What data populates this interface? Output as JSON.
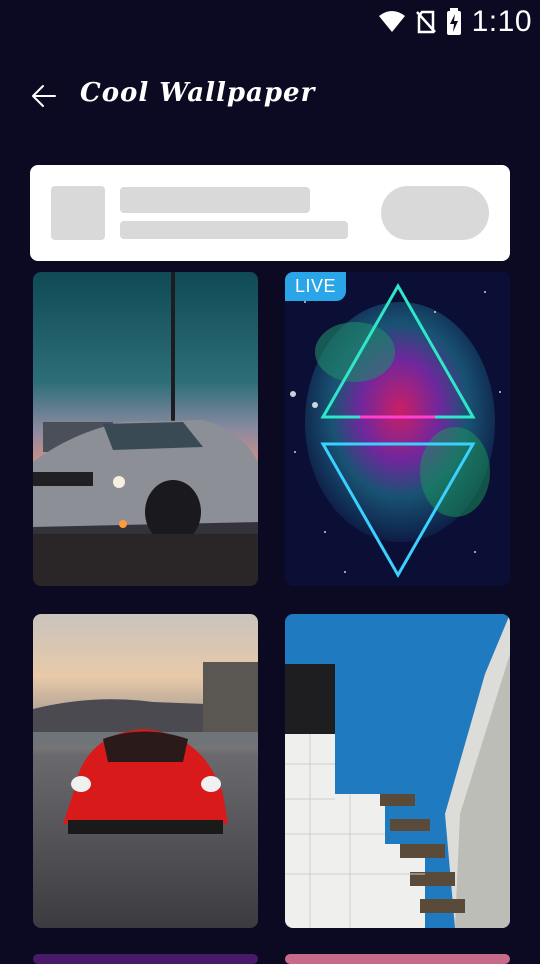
{
  "status_bar": {
    "time": "1:10",
    "icons": [
      "wifi-icon",
      "no-sim-icon",
      "battery-charging-icon"
    ]
  },
  "header": {
    "back_icon": "arrow-left-icon",
    "title": "Cool Wallpaper"
  },
  "wallpapers": [
    {
      "name": "wallpaper-muscle-car-dusk",
      "live": false
    },
    {
      "name": "wallpaper-neon-triangles-galaxy",
      "live": true,
      "badge": "LIVE"
    },
    {
      "name": "wallpaper-red-sports-car",
      "live": false
    },
    {
      "name": "wallpaper-white-building-blue-sky",
      "live": false
    }
  ],
  "colors": {
    "background": "#0c0a22",
    "live_badge": "#2aa6e8",
    "placeholder": "#d9d9d9"
  }
}
